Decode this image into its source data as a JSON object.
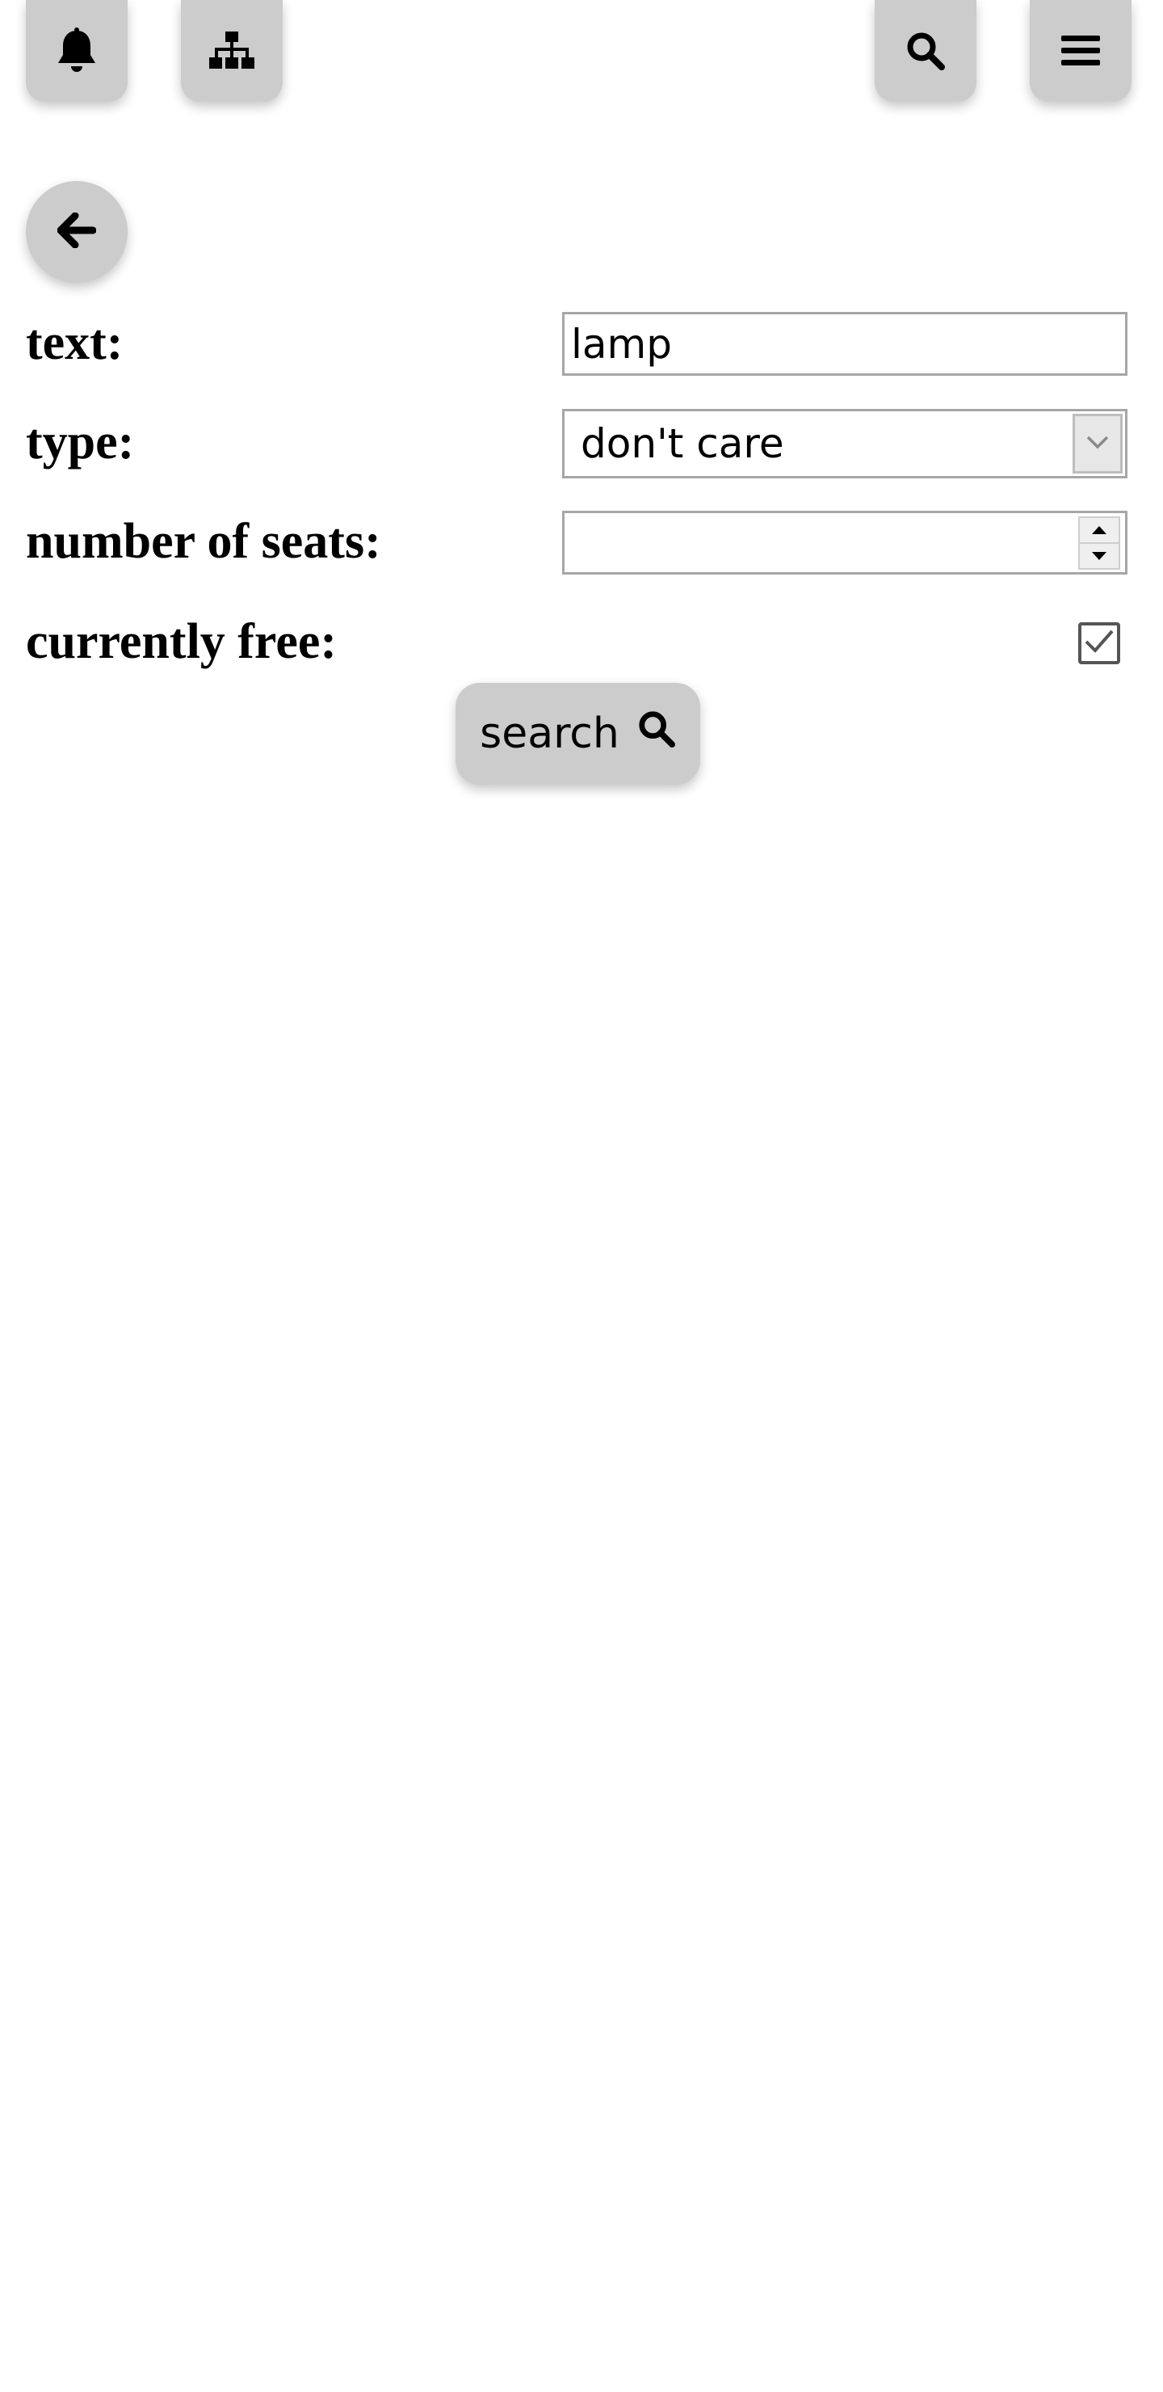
{
  "top_bar": {
    "icons": {
      "bell": "bell-icon",
      "sitemap": "sitemap-icon",
      "search": "search-icon",
      "menu": "hamburger-menu-icon"
    }
  },
  "back_button": {
    "icon": "arrow-left-icon"
  },
  "form": {
    "text_label": "text:",
    "text_value": "lamp",
    "type_label": "type:",
    "type_value": "don't care",
    "seats_label": "number of seats:",
    "seats_value": "",
    "free_label": "currently free:",
    "free_checked": true
  },
  "search_button": {
    "label": "search",
    "icon": "search-icon"
  },
  "colors": {
    "button_bg": "#cccccc",
    "field_border": "#a6a6a6",
    "background": "#ffffff"
  }
}
